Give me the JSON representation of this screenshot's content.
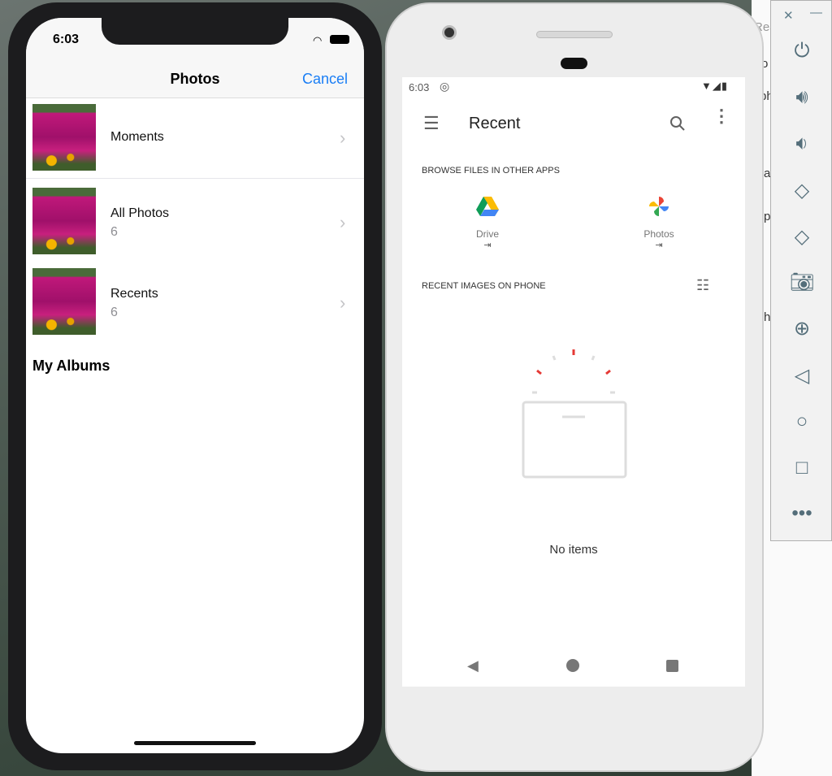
{
  "ios": {
    "time": "6:03",
    "nav_title": "Photos",
    "cancel": "Cancel",
    "accent": "#1a7ef5",
    "rows": [
      {
        "label": "Moments",
        "count": ""
      },
      {
        "label": "All Photos",
        "count": "6"
      },
      {
        "label": "Recents",
        "count": "6"
      }
    ],
    "section": "My Albums"
  },
  "android": {
    "time": "6:03",
    "toolbar_title": "Recent",
    "browse_header": "BROWSE FILES IN OTHER APPS",
    "apps": [
      {
        "label": "Drive",
        "icon": "google-drive-icon"
      },
      {
        "label": "Photos",
        "icon": "google-photos-icon"
      }
    ],
    "recent_header": "RECENT IMAGES ON PHONE",
    "empty": "No items"
  },
  "emulator_toolbar": {
    "buttons": [
      "power-icon",
      "volume-up-icon",
      "volume-down-icon",
      "rotate-left-icon",
      "rotate-right-icon",
      "camera-icon",
      "zoom-icon",
      "back-icon",
      "home-icon",
      "overview-icon",
      "more-icon"
    ],
    "icon_color": "#546e7a"
  },
  "background_window": {
    "fragments": [
      "Rea",
      "o",
      "ph",
      "a",
      "p",
      "h"
    ]
  }
}
